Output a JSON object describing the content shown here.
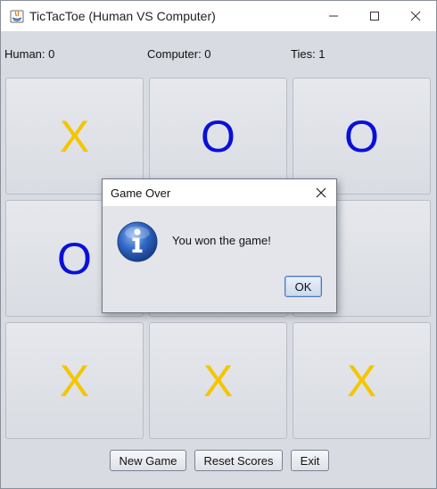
{
  "window": {
    "title": "TicTacToe (Human VS Computer)"
  },
  "scores": {
    "human": "Human: 0",
    "computer": "Computer: 0",
    "ties": "Ties: 1"
  },
  "board": {
    "cells": [
      "X",
      "O",
      "O",
      "O",
      "",
      "",
      "X",
      "X",
      "X"
    ],
    "x_color": "#f5c500",
    "o_color": "#0a10d8"
  },
  "buttons": {
    "new_game": "New Game",
    "reset_scores": "Reset Scores",
    "exit": "Exit"
  },
  "dialog": {
    "title": "Game Over",
    "message": "You won the game!",
    "ok_label": "OK",
    "icon": "info-icon"
  }
}
